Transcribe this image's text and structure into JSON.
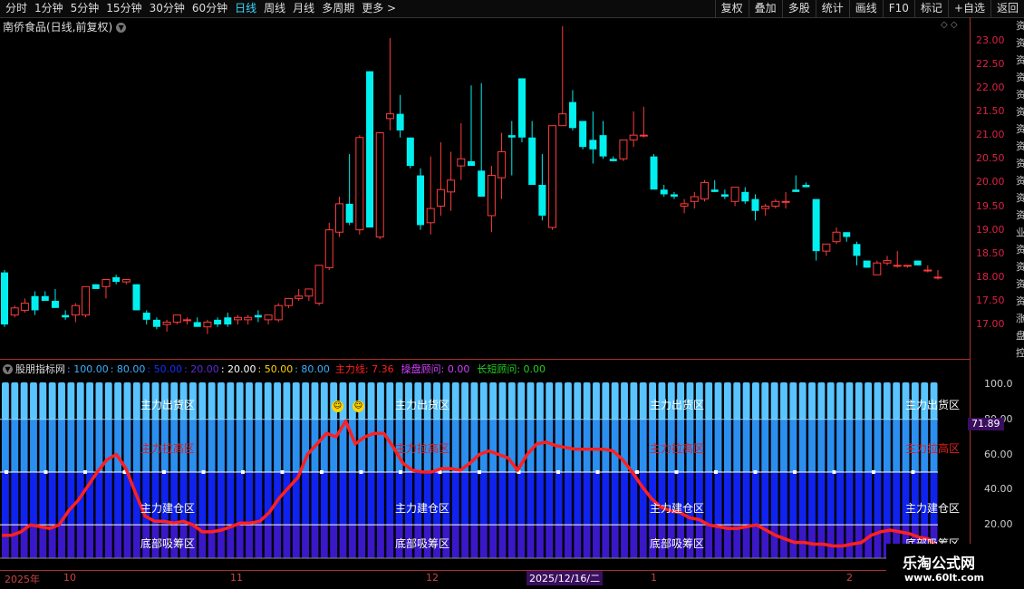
{
  "toolbar": {
    "periods": [
      "分时",
      "1分钟",
      "5分钟",
      "15分钟",
      "30分钟",
      "60分钟",
      "日线",
      "周线",
      "月线",
      "多周期",
      "更多"
    ],
    "active_period": "日线",
    "more_glyph": ">",
    "tools": [
      "复权",
      "叠加",
      "多股",
      "统计",
      "画线",
      "F10",
      "标记",
      "+自选",
      "返回"
    ]
  },
  "stock": {
    "title": "南侨食品(日线,前复权)"
  },
  "indicator": {
    "name": "股朋指标网",
    "params": [
      {
        "text": ": 100.00",
        "color": "#3ab0ff"
      },
      {
        "text": ": 80.00",
        "color": "#3ab0ff"
      },
      {
        "text": ": 50.00",
        "color": "#1030ff"
      },
      {
        "text": ": 20.00",
        "color": "#5a2bd8"
      },
      {
        "text": ": 20.00",
        "color": "#ffffff"
      },
      {
        "text": ": 50.00",
        "color": "#ffd400"
      },
      {
        "text": ": 80.00",
        "color": "#3ab0ff"
      }
    ],
    "main_line": "主力线: 7.36",
    "advisor": "操盘顾问: 0.00",
    "long_short": "长短顾问: 0.00",
    "colors": {
      "main": "#ff2020",
      "advisor": "#d040ff",
      "long_short": "#20d020"
    },
    "zones": {
      "top": "主力出货区",
      "high": "主力拉高区",
      "build": "主力建仓区",
      "bottom": "底部吸筹区"
    },
    "current_value": "71.89"
  },
  "price_axis": [
    "23.00",
    "22.50",
    "22.00",
    "21.50",
    "21.00",
    "20.50",
    "20.00",
    "19.50",
    "19.00",
    "18.50",
    "18.00",
    "17.50",
    "17.00"
  ],
  "indicator_axis": [
    "100.0",
    "80.00",
    "60.00",
    "40.00",
    "20.00"
  ],
  "dates": {
    "items": [
      "2025年",
      "10",
      "11",
      "12",
      "1",
      "2"
    ],
    "highlight": "2025/12/16/二"
  },
  "watermark": {
    "title": "乐淘公式网",
    "url": "www.60lt.com"
  },
  "edge_text": "资资资资资资资资资资资资业资资资资涨盘控利资资资资资资资资资资资资资",
  "colors": {
    "up": "#ff3c3c",
    "down": "#00f0f0",
    "background": "#000000"
  },
  "chart_data": [
    {
      "type": "candlestick",
      "title": "南侨食品(日线,前复权)",
      "ylim": [
        16.6,
        23.3
      ],
      "series": [
        {
          "name": "OHLC",
          "values": [
            [
              18.1,
              18.15,
              16.95,
              17.0
            ],
            [
              17.2,
              17.4,
              17.15,
              17.35
            ],
            [
              17.3,
              17.55,
              17.25,
              17.45
            ],
            [
              17.6,
              17.7,
              17.2,
              17.3
            ],
            [
              17.6,
              17.7,
              17.5,
              17.5
            ],
            [
              17.5,
              17.75,
              17.35,
              17.35
            ],
            [
              17.2,
              17.3,
              17.1,
              17.15
            ],
            [
              17.2,
              17.45,
              17.05,
              17.4
            ],
            [
              17.2,
              17.8,
              17.15,
              17.8
            ],
            [
              17.85,
              17.85,
              17.75,
              17.75
            ],
            [
              17.8,
              17.95,
              17.55,
              17.95
            ],
            [
              18.0,
              18.05,
              17.85,
              17.9
            ],
            [
              17.9,
              17.95,
              17.85,
              17.95
            ],
            [
              17.85,
              17.85,
              17.3,
              17.3
            ],
            [
              17.25,
              17.3,
              17.0,
              17.1
            ],
            [
              17.1,
              17.15,
              16.9,
              16.95
            ],
            [
              17.0,
              17.1,
              16.85,
              17.05
            ],
            [
              17.05,
              17.2,
              17.0,
              17.2
            ],
            [
              17.1,
              17.15,
              17.0,
              17.1
            ],
            [
              17.05,
              17.15,
              16.95,
              16.95
            ],
            [
              16.95,
              17.1,
              16.8,
              17.05
            ],
            [
              17.1,
              17.15,
              16.95,
              17.0
            ],
            [
              17.15,
              17.25,
              16.95,
              17.0
            ],
            [
              17.1,
              17.2,
              17.0,
              17.15
            ],
            [
              17.1,
              17.2,
              17.0,
              17.15
            ],
            [
              17.2,
              17.3,
              17.05,
              17.15
            ],
            [
              17.1,
              17.2,
              17.0,
              17.2
            ],
            [
              17.1,
              17.45,
              17.05,
              17.4
            ],
            [
              17.4,
              17.55,
              17.35,
              17.55
            ],
            [
              17.55,
              17.75,
              17.5,
              17.6
            ],
            [
              17.6,
              17.75,
              17.5,
              17.75
            ],
            [
              17.45,
              17.95,
              17.4,
              18.25
            ],
            [
              18.2,
              19.15,
              18.15,
              19.0
            ],
            [
              18.95,
              19.7,
              18.85,
              19.55
            ],
            [
              19.55,
              20.6,
              19.1,
              19.15
            ],
            [
              19.0,
              21.0,
              18.9,
              20.95
            ],
            [
              22.35,
              22.35,
              19.95,
              19.05
            ],
            [
              18.85,
              21.05,
              18.8,
              21.05
            ],
            [
              21.35,
              23.05,
              21.1,
              21.45
            ],
            [
              21.45,
              21.85,
              20.95,
              21.1
            ],
            [
              20.95,
              20.95,
              20.3,
              20.35
            ],
            [
              20.15,
              20.3,
              19.0,
              19.1
            ],
            [
              19.15,
              20.55,
              18.9,
              19.45
            ],
            [
              19.5,
              20.85,
              19.3,
              19.85
            ],
            [
              19.8,
              20.65,
              19.4,
              20.05
            ],
            [
              20.35,
              21.25,
              20.05,
              20.5
            ],
            [
              20.45,
              22.05,
              20.45,
              20.35
            ],
            [
              20.25,
              22.1,
              19.7,
              19.7
            ],
            [
              19.3,
              20.35,
              18.95,
              20.15
            ],
            [
              20.1,
              21.05,
              19.65,
              20.65
            ],
            [
              21.0,
              21.3,
              20.15,
              20.95
            ],
            [
              22.2,
              22.2,
              20.85,
              20.95
            ],
            [
              20.95,
              21.3,
              19.95,
              19.95
            ],
            [
              19.95,
              20.6,
              19.2,
              19.3
            ],
            [
              19.05,
              21.2,
              19.0,
              21.2
            ],
            [
              21.2,
              23.3,
              21.2,
              21.45
            ],
            [
              21.7,
              21.95,
              21.1,
              21.15
            ],
            [
              21.3,
              21.3,
              20.7,
              20.75
            ],
            [
              20.9,
              21.5,
              20.4,
              20.7
            ],
            [
              21.0,
              21.3,
              20.5,
              20.55
            ],
            [
              20.5,
              20.55,
              20.45,
              20.45
            ],
            [
              20.5,
              20.9,
              20.45,
              20.9
            ],
            [
              20.9,
              21.5,
              20.75,
              21.0
            ],
            [
              21.0,
              21.6,
              20.95,
              21.0
            ],
            [
              20.55,
              20.6,
              19.95,
              19.85
            ],
            [
              19.85,
              19.95,
              19.7,
              19.75
            ],
            [
              19.75,
              19.8,
              19.65,
              19.7
            ],
            [
              19.5,
              19.65,
              19.35,
              19.55
            ],
            [
              19.6,
              19.8,
              19.45,
              19.7
            ],
            [
              19.65,
              20.05,
              19.6,
              20.0
            ],
            [
              19.85,
              20.05,
              19.8,
              19.8
            ],
            [
              19.75,
              19.85,
              19.65,
              19.7
            ],
            [
              19.6,
              19.85,
              19.5,
              19.9
            ],
            [
              19.8,
              19.9,
              19.55,
              19.6
            ],
            [
              19.65,
              19.75,
              19.2,
              19.4
            ],
            [
              19.45,
              19.55,
              19.3,
              19.5
            ],
            [
              19.5,
              19.65,
              19.45,
              19.6
            ],
            [
              19.6,
              19.8,
              19.45,
              19.6
            ],
            [
              19.85,
              20.15,
              19.8,
              19.8
            ],
            [
              19.95,
              20.0,
              19.9,
              19.9
            ],
            [
              19.65,
              19.65,
              18.35,
              18.55
            ],
            [
              18.55,
              18.7,
              18.45,
              18.7
            ],
            [
              18.75,
              19.05,
              18.7,
              18.95
            ],
            [
              18.95,
              18.95,
              18.75,
              18.85
            ],
            [
              18.7,
              18.75,
              18.25,
              18.45
            ],
            [
              18.35,
              18.35,
              18.2,
              18.2
            ],
            [
              18.05,
              18.35,
              18.05,
              18.3
            ],
            [
              18.3,
              18.45,
              18.25,
              18.35
            ],
            [
              18.25,
              18.55,
              18.2,
              18.25
            ],
            [
              18.25,
              18.25,
              18.2,
              18.25
            ],
            [
              18.35,
              18.35,
              18.25,
              18.25
            ],
            [
              18.15,
              18.25,
              18.1,
              18.15
            ],
            [
              18.0,
              18.15,
              17.95,
              18.0
            ]
          ]
        }
      ]
    },
    {
      "type": "line",
      "title": "股朋指标网",
      "ylim": [
        0,
        102
      ],
      "series": [
        {
          "name": "主力线",
          "values": [
            14,
            14,
            16,
            20,
            19,
            18,
            20,
            28,
            34,
            42,
            50,
            57,
            60,
            52,
            38,
            25,
            22,
            22,
            21,
            22,
            20,
            16,
            16,
            17,
            19,
            21,
            21,
            22,
            27,
            35,
            41,
            47,
            60,
            66,
            72,
            70,
            79,
            66,
            70,
            72,
            72,
            64,
            55,
            51,
            50,
            50,
            52,
            52,
            51,
            55,
            60,
            62,
            60,
            58,
            51,
            60,
            66,
            67,
            65,
            64,
            63,
            63,
            63,
            63,
            62,
            57,
            50,
            42,
            35,
            30,
            28,
            27,
            24,
            23,
            20,
            19,
            18,
            18,
            19,
            20,
            17,
            14,
            12,
            10,
            10,
            9,
            9,
            8,
            8,
            9,
            10,
            14,
            16,
            17,
            16,
            15,
            13,
            12,
            7
          ]
        }
      ]
    }
  ]
}
